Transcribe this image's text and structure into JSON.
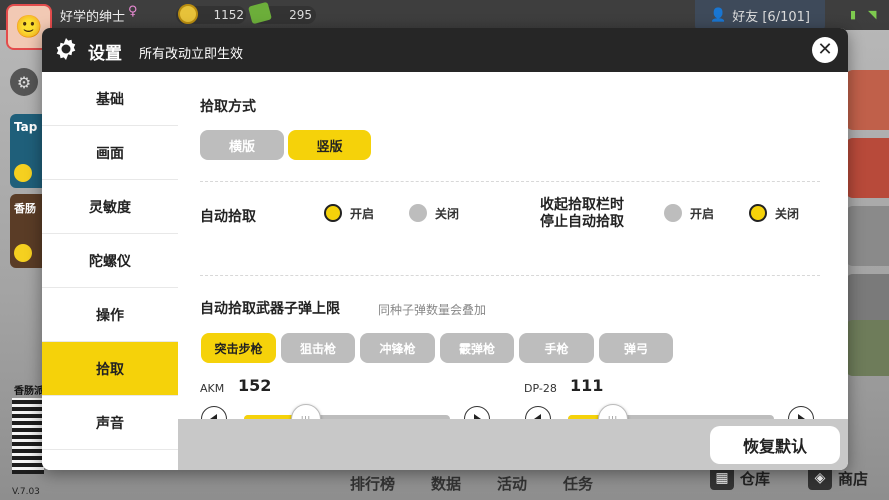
{
  "hud": {
    "player_name": "好学的绅士",
    "coins": "1152",
    "cash": "295",
    "friends_label": "好友 [6/101]",
    "tap_card_label": "Tap",
    "sausage_card_label": "香肠",
    "qr_label": "香肠派",
    "version": "V.7.03",
    "bottom_tabs": [
      "排行榜",
      "数据",
      "活动",
      "任务"
    ],
    "warehouse_label": "仓库",
    "shop_label": "商店"
  },
  "modal": {
    "title": "设置",
    "subtitle": "所有改动立即生效",
    "close_symbol": "✕",
    "sidebar": [
      {
        "label": "基础",
        "active": false
      },
      {
        "label": "画面",
        "active": false
      },
      {
        "label": "灵敏度",
        "active": false
      },
      {
        "label": "陀螺仪",
        "active": false
      },
      {
        "label": "操作",
        "active": false
      },
      {
        "label": "拾取",
        "active": true
      },
      {
        "label": "声音",
        "active": false
      }
    ],
    "pickup_mode": {
      "title": "拾取方式",
      "options": [
        {
          "label": "横版",
          "selected": false
        },
        {
          "label": "竖版",
          "selected": true
        }
      ]
    },
    "auto_pickup": {
      "title": "自动拾取",
      "on_label": "开启",
      "off_label": "关闭",
      "value": "on"
    },
    "stop_auto_pickup": {
      "title_line1": "收起拾取栏时",
      "title_line2": "停止自动拾取",
      "on_label": "开启",
      "off_label": "关闭",
      "value": "off"
    },
    "ammo_limit": {
      "title": "自动拾取武器子弹上限",
      "hint": "同种子弹数量会叠加",
      "categories": [
        {
          "label": "突击步枪",
          "selected": true
        },
        {
          "label": "狙击枪",
          "selected": false
        },
        {
          "label": "冲锋枪",
          "selected": false
        },
        {
          "label": "霰弹枪",
          "selected": false
        },
        {
          "label": "手枪",
          "selected": false
        },
        {
          "label": "弹弓",
          "selected": false
        }
      ],
      "weapons": [
        {
          "name": "AKM",
          "value": "152",
          "fraction": 0.3
        },
        {
          "name": "DP-28",
          "value": "111",
          "fraction": 0.22
        }
      ],
      "thumb_grip": "III"
    },
    "reset_label": "恢复默认"
  },
  "colors": {
    "accent": "#f5d20a",
    "header_bg": "#262626",
    "inactive_chip": "#bdbdbd",
    "footer_bg": "#c8c8c8"
  }
}
